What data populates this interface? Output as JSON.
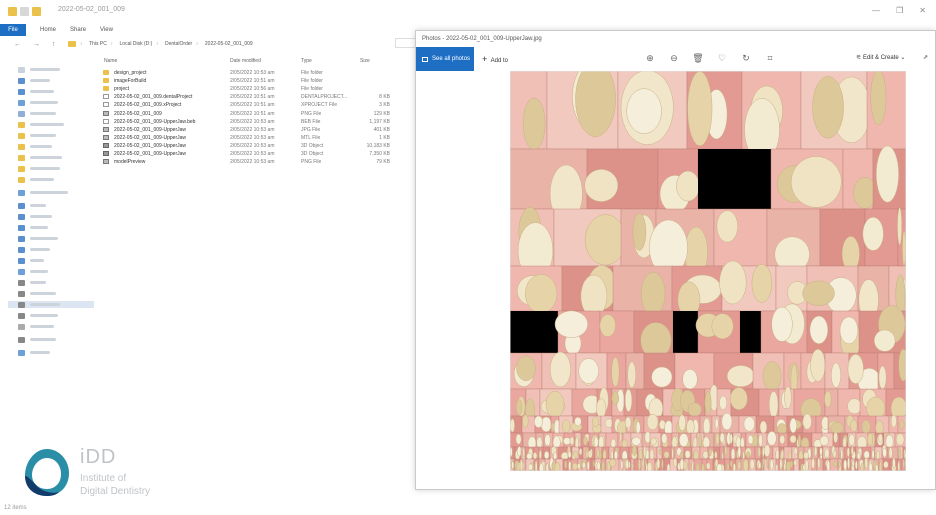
{
  "explorer": {
    "title": "2022-05-02_001_009",
    "ribbon": {
      "file": "File",
      "home": "Home",
      "share": "Share",
      "view": "View"
    },
    "address": {
      "nav_arrows": "← → ↑",
      "crumbs": [
        "This PC",
        "Local Disk (D:)",
        "DentalOrder",
        "2022-05-02_001_009"
      ]
    },
    "columns": {
      "name": "Name",
      "date": "Date modified",
      "type": "Type",
      "size": "Size"
    },
    "files": [
      {
        "name": "design_project",
        "date": "2/05/2022 10:53 am",
        "type": "File folder",
        "size": "",
        "icon": "folder"
      },
      {
        "name": "imageForBuild",
        "date": "2/05/2022 10:51 am",
        "type": "File folder",
        "size": "",
        "icon": "folder"
      },
      {
        "name": "project",
        "date": "2/05/2022 10:56 am",
        "type": "File folder",
        "size": "",
        "icon": "folder"
      },
      {
        "name": "2022-05-02_001_009.dentalProject",
        "date": "2/05/2022 10:51 am",
        "type": "DENTALPROJECT...",
        "size": "8 KB",
        "icon": "file"
      },
      {
        "name": "2022-05-02_001_009.xProject",
        "date": "2/05/2022 10:51 am",
        "type": "XPROJECT File",
        "size": "3 KB",
        "icon": "file"
      },
      {
        "name": "2022-05-02_001_009",
        "date": "2/05/2022 10:51 am",
        "type": "PNG File",
        "size": "129 KB",
        "icon": "image"
      },
      {
        "name": "2022-05-02_001_009-UpperJaw.beb",
        "date": "2/05/2022 10:53 am",
        "type": "BEB File",
        "size": "1,197 KB",
        "icon": "file"
      },
      {
        "name": "2022-05-02_001_009-UpperJaw",
        "date": "2/05/2022 10:53 am",
        "type": "JPG File",
        "size": "401 KB",
        "icon": "image"
      },
      {
        "name": "2022-05-02_001_009-UpperJaw",
        "date": "2/05/2022 10:53 am",
        "type": "MTL File",
        "size": "1 KB",
        "icon": "image"
      },
      {
        "name": "2022-05-02_001_009-UpperJaw",
        "date": "2/05/2022 10:53 am",
        "type": "3D Object",
        "size": "10,183 KB",
        "icon": "3d"
      },
      {
        "name": "2022-05-02_001_009-UpperJaw",
        "date": "2/05/2022 10:53 am",
        "type": "3D Object",
        "size": "7,350 KB",
        "icon": "3d"
      },
      {
        "name": "modelPreview",
        "date": "2/05/2022 10:53 am",
        "type": "PNG File",
        "size": "79 KB",
        "icon": "image"
      }
    ],
    "status": "12 items"
  },
  "logo": {
    "mark": "iDD",
    "line1": "Institute of",
    "line2": "Digital Dentistry"
  },
  "photos": {
    "title": "Photos - 2022-05-02_001_009-UpperJaw.jpg",
    "see_all": "See all photos",
    "add_to": "Add to",
    "edit_create": "Edit & Create",
    "share": "Share",
    "toolbar_icons": [
      "zoom-in-icon",
      "zoom-out-icon",
      "delete-icon",
      "favorite-icon",
      "rotate-icon",
      "crop-icon"
    ]
  },
  "colors": {
    "accent": "#1e6fc4",
    "folder": "#e9c14b",
    "logo_teal": "#2a8fa6",
    "logo_navy": "#123a6b"
  }
}
